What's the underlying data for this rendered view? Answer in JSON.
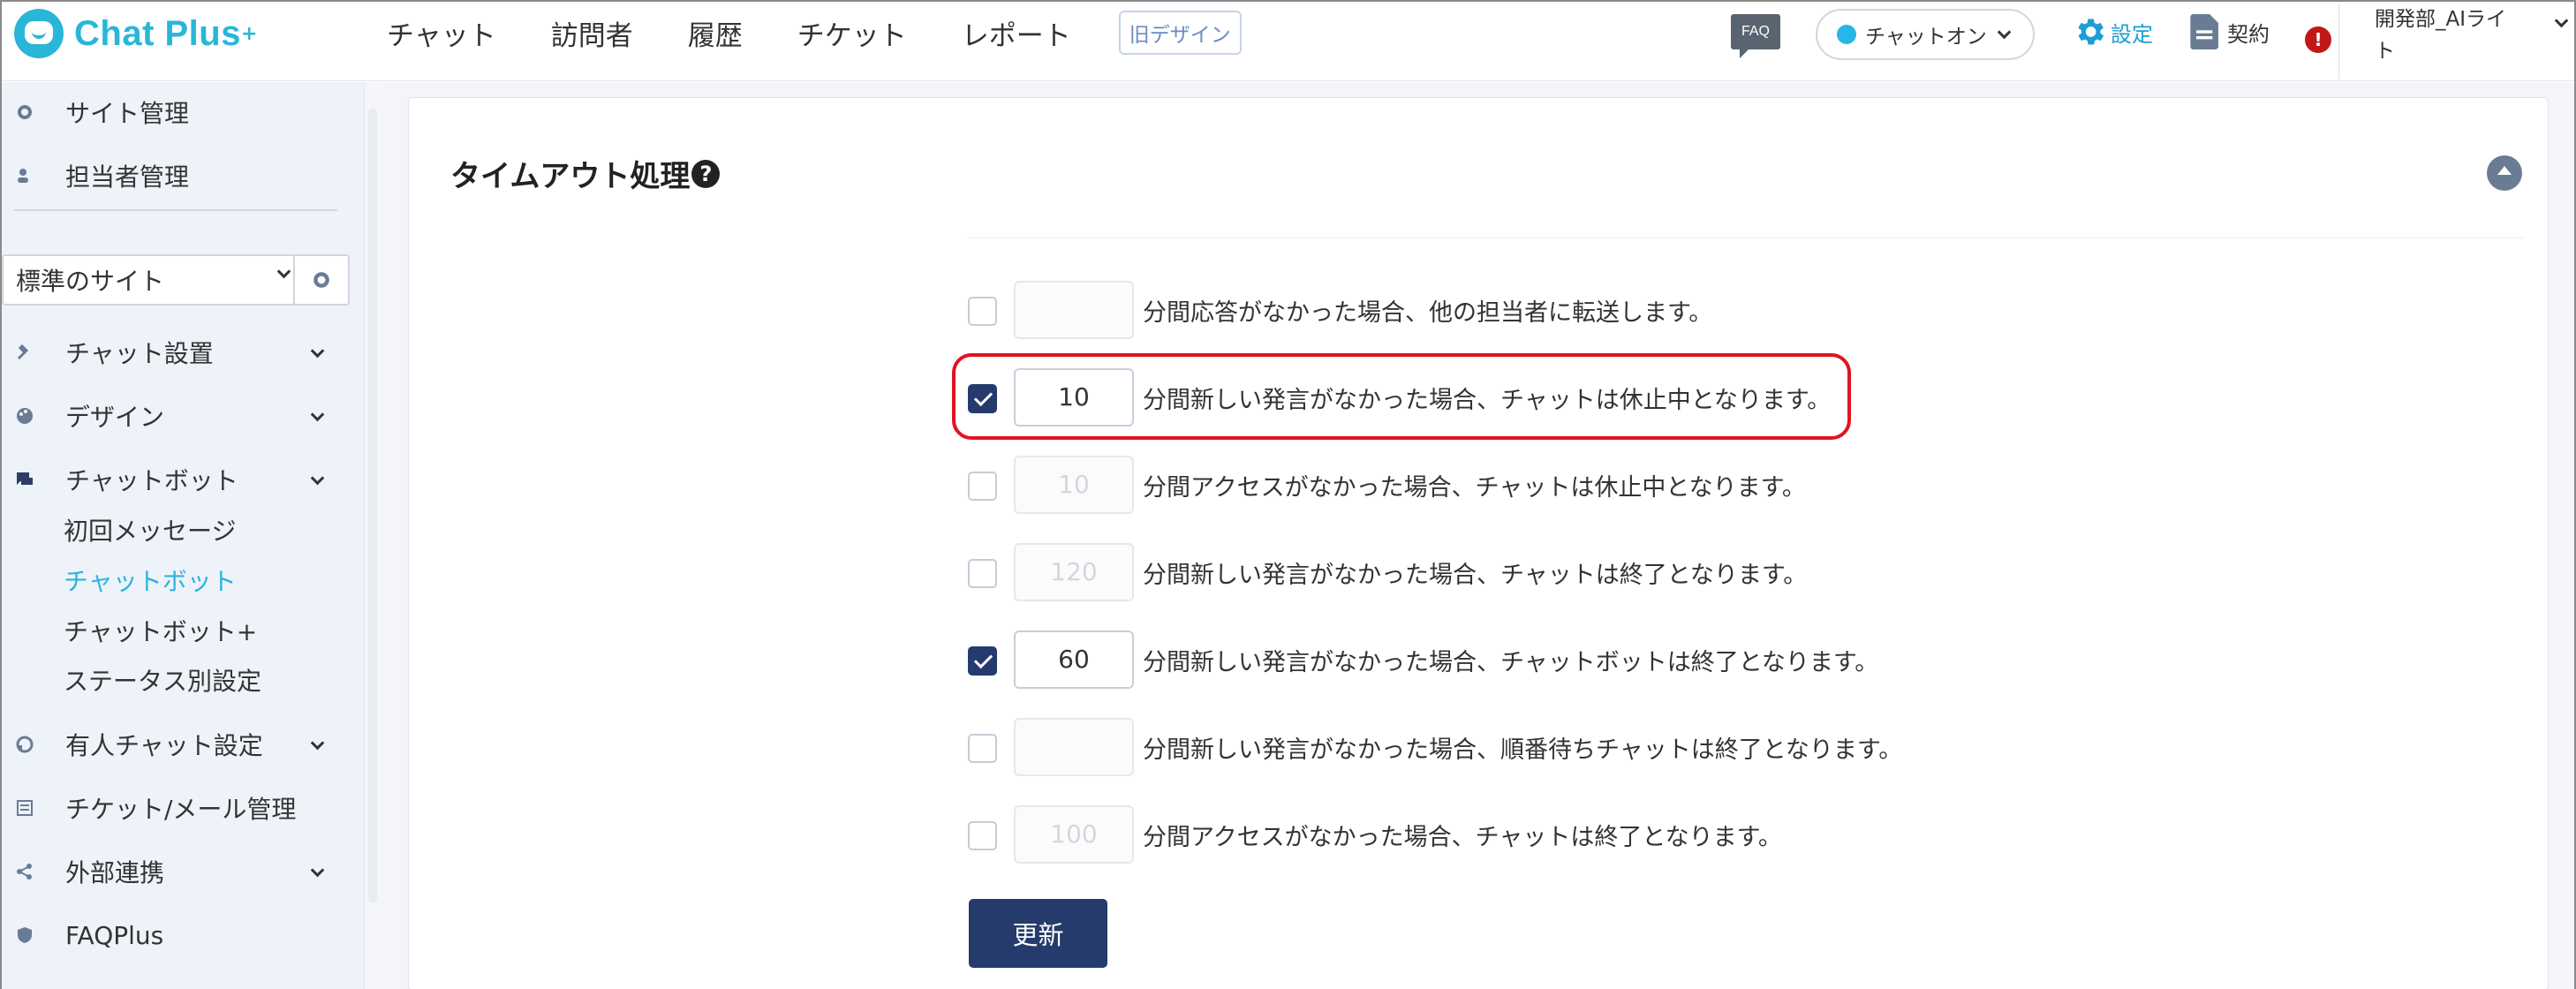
{
  "app": {
    "logo_text": "Chat Plus",
    "logo_plus": "+"
  },
  "nav": {
    "items": [
      "チャット",
      "訪問者",
      "履歴",
      "チケット",
      "レポート"
    ],
    "old_design": "旧デザイン"
  },
  "header": {
    "faq": "FAQ",
    "chat_status": "チャットオン",
    "settings": "設定",
    "contract": "契約",
    "alert": "!",
    "user_line1": "開発部_AIライ",
    "user_line2": "ト"
  },
  "sidebar": {
    "site_mgmt": "サイト管理",
    "staff_mgmt": "担当者管理",
    "site_select": "標準のサイト",
    "items": [
      {
        "label": "チャット設置",
        "icon": "tools-icon"
      },
      {
        "label": "デザイン",
        "icon": "palette-icon"
      },
      {
        "label": "チャットボット",
        "icon": "chat-icon"
      }
    ],
    "sub_items": [
      "初回メッセージ",
      "チャットボット",
      "チャットボット+",
      "ステータス別設定"
    ],
    "items2": [
      {
        "label": "有人チャット設定",
        "icon": "operator-icon"
      },
      {
        "label": "チケット/メール管理",
        "icon": "list-icon"
      },
      {
        "label": "外部連携",
        "icon": "share-icon"
      },
      {
        "label": "FAQPlus",
        "icon": "faq-icon"
      }
    ]
  },
  "panel": {
    "title": "タイムアウト処理",
    "rows": [
      {
        "checked": false,
        "value": "",
        "label": "分間応答がなかった場合、他の担当者に転送します。"
      },
      {
        "checked": true,
        "value": "10",
        "label": "分間新しい発言がなかった場合、チャットは休止中となります。"
      },
      {
        "checked": false,
        "value": "10",
        "label": "分間アクセスがなかった場合、チャットは休止中となります。"
      },
      {
        "checked": false,
        "value": "120",
        "label": "分間新しい発言がなかった場合、チャットは終了となります。"
      },
      {
        "checked": true,
        "value": "60",
        "label": "分間新しい発言がなかった場合、チャットボットは終了となります。"
      },
      {
        "checked": false,
        "value": "",
        "label": "分間新しい発言がなかった場合、順番待ちチャットは終了となります。"
      },
      {
        "checked": false,
        "value": "100",
        "label": "分間アクセスがなかった場合、チャットは終了となります。"
      }
    ],
    "update_button": "更新"
  },
  "colors": {
    "accent": "#29b6d8",
    "primary": "#243b6b",
    "highlight": "#e0141e",
    "active_link": "#2bb3df"
  }
}
